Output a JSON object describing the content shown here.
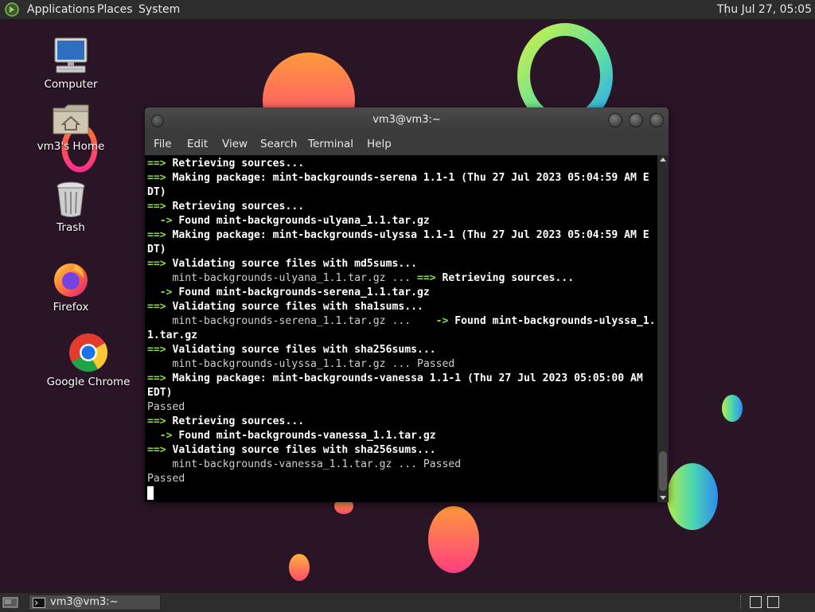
{
  "top_panel": {
    "menus": [
      "Applications",
      "Places",
      "System"
    ],
    "clock": "Thu Jul 27, 05:05"
  },
  "desktop_icons": [
    {
      "label": "Computer",
      "icon": "computer-icon"
    },
    {
      "label": "vm3's Home",
      "icon": "home-folder-icon"
    },
    {
      "label": "Trash",
      "icon": "trash-icon"
    },
    {
      "label": "Firefox",
      "icon": "firefox-icon"
    },
    {
      "label": "Google Chrome",
      "icon": "chrome-icon"
    }
  ],
  "terminal": {
    "title": "vm3@vm3:~",
    "menus": [
      "File",
      "Edit",
      "View",
      "Search",
      "Terminal",
      "Help"
    ],
    "lines": [
      [
        {
          "t": "==> ",
          "c": "g"
        },
        {
          "t": "Retrieving sources...",
          "c": "b"
        }
      ],
      [
        {
          "t": "==> ",
          "c": "g"
        },
        {
          "t": "Making package: mint-backgrounds-serena 1.1-1 (Thu 27 Jul 2023 05:04:59 AM E",
          "c": "b"
        }
      ],
      [
        {
          "t": "DT)",
          "c": "b"
        }
      ],
      [
        {
          "t": "==> ",
          "c": "g"
        },
        {
          "t": "Retrieving sources...",
          "c": "b"
        }
      ],
      [
        {
          "t": "  -> ",
          "c": "g"
        },
        {
          "t": "Found mint-backgrounds-ulyana_1.1.tar.gz",
          "c": "b"
        }
      ],
      [
        {
          "t": "==> ",
          "c": "g"
        },
        {
          "t": "Making package: mint-backgrounds-ulyssa 1.1-1 (Thu 27 Jul 2023 05:04:59 AM E",
          "c": "b"
        }
      ],
      [
        {
          "t": "DT)",
          "c": "b"
        }
      ],
      [
        {
          "t": "==> ",
          "c": "g"
        },
        {
          "t": "Validating source files with md5sums...",
          "c": "b"
        }
      ],
      [
        {
          "t": "    mint-backgrounds-ulyana_1.1.tar.gz ... ",
          "c": "n"
        },
        {
          "t": "==> ",
          "c": "g"
        },
        {
          "t": "Retrieving sources...",
          "c": "b"
        }
      ],
      [
        {
          "t": "  -> ",
          "c": "g"
        },
        {
          "t": "Found mint-backgrounds-serena_1.1.tar.gz",
          "c": "b"
        }
      ],
      [
        {
          "t": "==> ",
          "c": "g"
        },
        {
          "t": "Validating source files with sha1sums...",
          "c": "b"
        }
      ],
      [
        {
          "t": "    mint-backgrounds-serena_1.1.tar.gz ...    ",
          "c": "n"
        },
        {
          "t": "-> ",
          "c": "g"
        },
        {
          "t": "Found mint-backgrounds-ulyssa_1.",
          "c": "b"
        }
      ],
      [
        {
          "t": "1.tar.gz",
          "c": "b"
        }
      ],
      [
        {
          "t": "==> ",
          "c": "g"
        },
        {
          "t": "Validating source files with sha256sums...",
          "c": "b"
        }
      ],
      [
        {
          "t": "    mint-backgrounds-ulyssa_1.1.tar.gz ... Passed",
          "c": "n"
        }
      ],
      [
        {
          "t": "==> ",
          "c": "g"
        },
        {
          "t": "Making package: mint-backgrounds-vanessa 1.1-1 (Thu 27 Jul 2023 05:05:00 AM",
          "c": "b"
        }
      ],
      [
        {
          "t": "EDT)",
          "c": "b"
        }
      ],
      [
        {
          "t": "Passed",
          "c": "n"
        }
      ],
      [
        {
          "t": "==> ",
          "c": "g"
        },
        {
          "t": "Retrieving sources...",
          "c": "b"
        }
      ],
      [
        {
          "t": "  -> ",
          "c": "g"
        },
        {
          "t": "Found mint-backgrounds-vanessa_1.1.tar.gz",
          "c": "b"
        }
      ],
      [
        {
          "t": "==> ",
          "c": "g"
        },
        {
          "t": "Validating source files with sha256sums...",
          "c": "b"
        }
      ],
      [
        {
          "t": "    mint-backgrounds-vanessa_1.1.tar.gz ... Passed",
          "c": "n"
        }
      ],
      [
        {
          "t": "Passed",
          "c": "n"
        }
      ]
    ]
  },
  "bottom_panel": {
    "task": "vm3@vm3:~"
  },
  "colors": {
    "prompt_green": "#8ae234",
    "desktop_bg": "#2a1526",
    "panel_bg": "#2d2d2d"
  }
}
